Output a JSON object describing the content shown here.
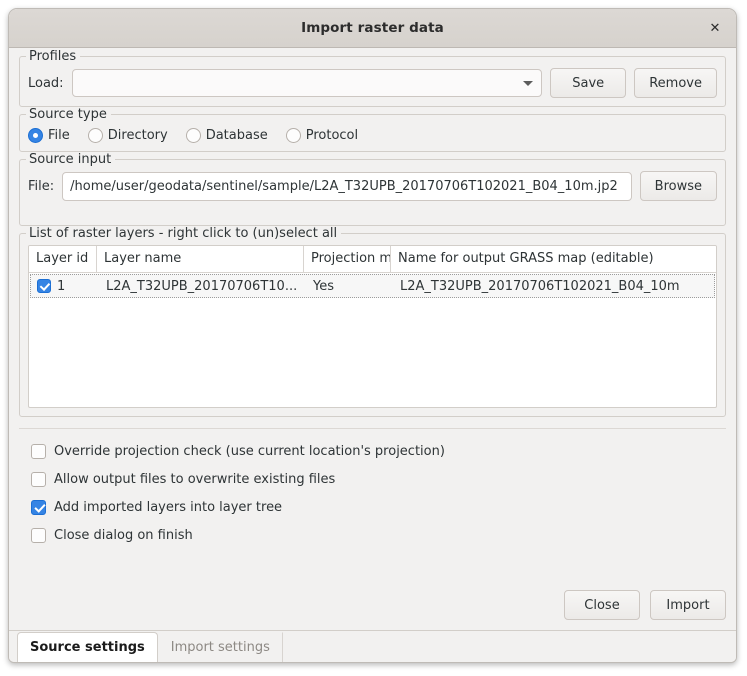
{
  "window": {
    "title": "Import raster data",
    "close_icon": "close-icon",
    "close_glyph": "✕"
  },
  "profiles": {
    "group_title": "Profiles",
    "load_label": "Load:",
    "combo_value": "",
    "combo_placeholder": "",
    "save_label": "Save",
    "remove_label": "Remove"
  },
  "source_type": {
    "group_title": "Source type",
    "options": [
      {
        "label": "File",
        "selected": true
      },
      {
        "label": "Directory",
        "selected": false
      },
      {
        "label": "Database",
        "selected": false
      },
      {
        "label": "Protocol",
        "selected": false
      }
    ]
  },
  "source_input": {
    "group_title": "Source input",
    "file_label": "File:",
    "file_value": "/home/user/geodata/sentinel/sample/L2A_T32UPB_20170706T102021_B04_10m.jp2",
    "browse_label": "Browse"
  },
  "layers": {
    "group_title": "List of raster layers - right click to (un)select all",
    "columns": [
      "Layer id",
      "Layer name",
      "Projection m",
      "Name for output GRASS map (editable)"
    ],
    "rows": [
      {
        "checked": true,
        "layer_id": "1",
        "layer_name": "L2A_T32UPB_20170706T10...",
        "projection_match": "Yes",
        "output_name": "L2A_T32UPB_20170706T102021_B04_10m"
      }
    ]
  },
  "options": [
    {
      "label": "Override projection check (use current location's projection)",
      "checked": false
    },
    {
      "label": "Allow output files to overwrite existing files",
      "checked": false
    },
    {
      "label": "Add imported layers into layer tree",
      "checked": true
    },
    {
      "label": "Close dialog on finish",
      "checked": false
    }
  ],
  "actions": {
    "close_label": "Close",
    "import_label": "Import"
  },
  "tabs": [
    {
      "label": "Source settings",
      "active": true
    },
    {
      "label": "Import settings",
      "active": false
    }
  ],
  "colors": {
    "accent": "#3584e4",
    "dialog_bg": "#f2f1f0",
    "titlebar_bg": "#d6d2cd",
    "field_bg": "#ffffff",
    "text": "#2e3436",
    "muted_text": "#8d8984",
    "border": "#cdc7c2"
  }
}
